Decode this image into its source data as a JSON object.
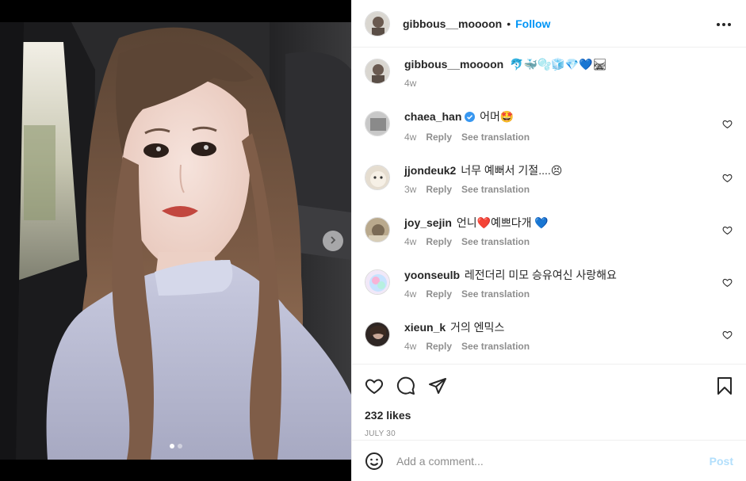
{
  "header": {
    "username": "gibbous__moooon",
    "separator": "•",
    "follow_label": "Follow"
  },
  "caption": {
    "username": "gibbous__moooon",
    "text": "🐬🐳🫧🧊💎💙🛤",
    "time": "4w"
  },
  "comments": [
    {
      "user": "chaea_han",
      "verified": true,
      "text": "어머🤩",
      "time": "4w",
      "reply": "Reply",
      "translate": "See translation"
    },
    {
      "user": "jjondeuk2",
      "verified": false,
      "text": "너무 예뻐서 기절....😣",
      "time": "3w",
      "reply": "Reply",
      "translate": "See translation"
    },
    {
      "user": "joy_sejin",
      "verified": false,
      "text": "언니❤️예쁘다개 💙",
      "time": "4w",
      "reply": "Reply",
      "translate": "See translation"
    },
    {
      "user": "yoonseulb",
      "verified": false,
      "text": "레전더리 미모 승유여신 사랑해요",
      "time": "4w",
      "reply": "Reply",
      "translate": "See translation"
    },
    {
      "user": "xieun_k",
      "verified": false,
      "text": "거의 엔믹스",
      "time": "4w",
      "reply": "Reply",
      "translate": "See translation"
    }
  ],
  "post": {
    "likes": "232 likes",
    "date": "JULY 30"
  },
  "comment_box": {
    "placeholder": "Add a comment...",
    "post_label": "Post"
  },
  "carousel": {
    "total": 2,
    "active": 1
  },
  "colors": {
    "accent": "#0095f6",
    "post_disabled": "#b2dffc",
    "verified": "#3897f0"
  },
  "icons": {
    "like": "heart-icon",
    "comment": "comment-icon",
    "share": "share-icon",
    "save": "bookmark-icon",
    "emoji": "smiley-icon",
    "more": "more-icon",
    "next": "chevron-right-icon"
  }
}
